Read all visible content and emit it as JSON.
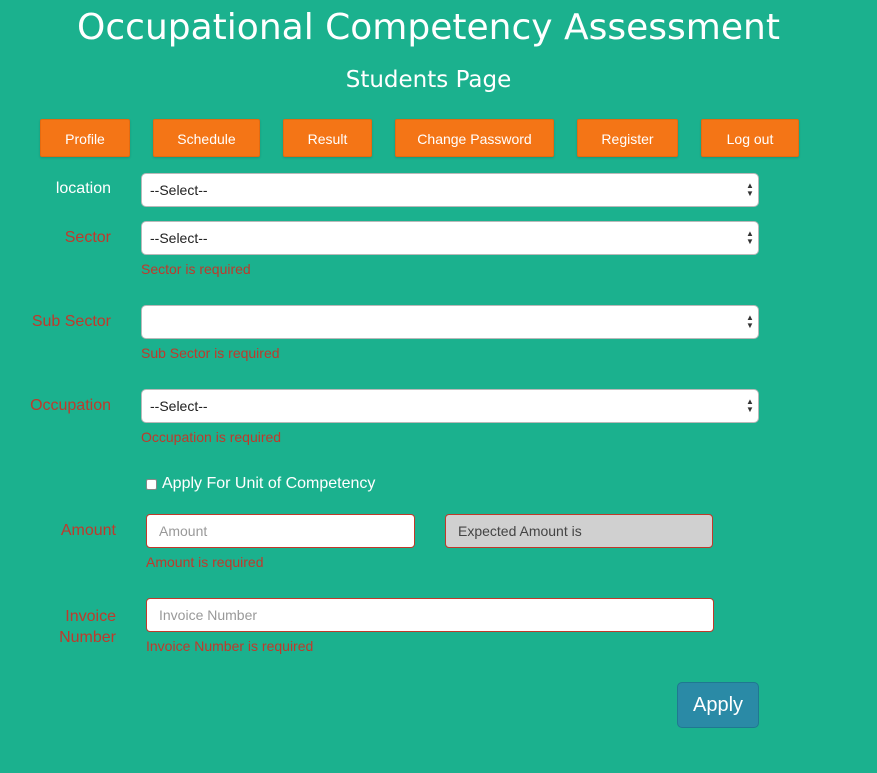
{
  "header": {
    "title": "Occupational Competency Assessment",
    "subtitle": "Students Page"
  },
  "nav": {
    "profile": "Profile",
    "schedule": "Schedule",
    "result": "Result",
    "change_password": "Change Password",
    "register": "Register",
    "logout": "Log out"
  },
  "form": {
    "location": {
      "label": "location",
      "value": "--Select--"
    },
    "sector": {
      "label": "Sector",
      "value": "--Select--",
      "error": "Sector is required"
    },
    "sub_sector": {
      "label": "Sub Sector",
      "value": "",
      "error": "Sub Sector is required"
    },
    "occupation": {
      "label": "Occupation",
      "value": "--Select--",
      "error": "Occupation is required"
    },
    "unit_checkbox": {
      "label": "Apply For Unit of Competency",
      "checked": false
    },
    "amount": {
      "label": "Amount",
      "placeholder": "Amount",
      "value": "",
      "error": "Amount is required",
      "expected_text": "Expected Amount is"
    },
    "invoice": {
      "label_line1": "Invoice",
      "label_line2": "Number",
      "placeholder": "Invoice Number",
      "value": "",
      "error": "Invoice Number is required"
    },
    "apply_label": "Apply"
  },
  "colors": {
    "background": "#1bb18e",
    "nav_button": "#f47516",
    "error": "#c0392b",
    "apply_button": "#2a8aa6"
  }
}
